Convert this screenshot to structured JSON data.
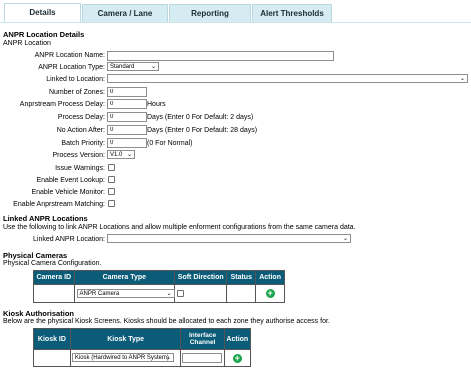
{
  "tabs": [
    {
      "label": "Details"
    },
    {
      "label": "Camera / Lane"
    },
    {
      "label": "Reporting"
    },
    {
      "label": "Alert Thresholds"
    }
  ],
  "details": {
    "title": "ANPR Location Details",
    "subtitle": "ANPR Location",
    "fields": {
      "name": {
        "label": "ANPR Location Name:",
        "value": ""
      },
      "type": {
        "label": "ANPR Location Type:",
        "value": "Standard"
      },
      "linked": {
        "label": "Linked to Location:",
        "value": ""
      },
      "zones": {
        "label": "Number of Zones:",
        "value": "0"
      },
      "anprstream_delay": {
        "label": "Anprstream Process Delay:",
        "value": "0",
        "suffix": "Hours"
      },
      "process_delay": {
        "label": "Process Delay:",
        "value": "0",
        "suffix": "Days (Enter 0 For Default: 2 days)"
      },
      "no_action_after": {
        "label": "No Action After:",
        "value": "0",
        "suffix": "Days (Enter 0 For Default: 28 days)"
      },
      "batch_priority": {
        "label": "Batch Priority:",
        "value": "0",
        "suffix": "(0 For Normal)"
      },
      "process_version": {
        "label": "Process Version:",
        "value": "V1.0"
      },
      "issue_warnings": {
        "label": "Issue Warnings:"
      },
      "enable_event_lookup": {
        "label": "Enable Event Lookup:"
      },
      "enable_vehicle_monitor": {
        "label": "Enable Vehicle Monitor:"
      },
      "enable_anprstream_matching": {
        "label": "Enable Anprstream Matching:"
      }
    }
  },
  "linked_section": {
    "title": "Linked ANPR Locations",
    "description": "Use the following to link ANPR Locations and allow multiple enforment configurations from the same camera data.",
    "field_label": "Linked ANPR Location:",
    "value": ""
  },
  "cameras": {
    "title": "Physical Cameras",
    "subtitle": "Physical Camera Configuration.",
    "headers": [
      "Camera ID",
      "Camera Type",
      "Soft Direction",
      "Status",
      "Action"
    ],
    "row": {
      "camera_type": "ANPR Camera"
    }
  },
  "kiosk": {
    "title": "Kiosk Authorisation",
    "description": "Below are the physical Kiosk Screens. Kiosks should be allocated to each zone they authorise access for.",
    "headers": [
      "Kiosk ID",
      "Kiosk Type",
      "Interface Channel",
      "Action"
    ],
    "row": {
      "kiosk_type": "Kiosk (Hardwired to ANPR System)"
    }
  },
  "colors": {
    "tab_bg": "#d4ecf2",
    "table_header": "#0b5c78",
    "add_button": "#1aa34a"
  }
}
